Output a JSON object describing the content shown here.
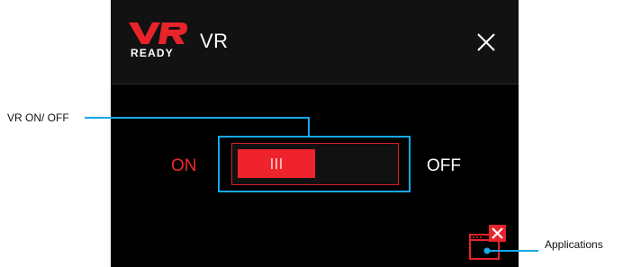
{
  "window": {
    "title": "VR",
    "logo": {
      "primary": "VR",
      "secondary": "READY",
      "icon": "vr-ready-logo"
    },
    "close_icon": "close-icon"
  },
  "toggle": {
    "on_label": "ON",
    "off_label": "OFF",
    "state": "on",
    "knob_fraction": 0.5,
    "knob_icon": "grip-lines-icon"
  },
  "applications_button": {
    "icon": "applications-window-close-icon"
  },
  "callouts": {
    "vr_toggle": "VR ON/ OFF",
    "applications": "Applications"
  },
  "colors": {
    "accent_red": "#ee232c",
    "callout_blue": "#17a9e6",
    "window_bg": "#000000",
    "titlebar_bg": "#121212",
    "on_text": "#ee2a2a",
    "off_text": "#ffffff"
  }
}
